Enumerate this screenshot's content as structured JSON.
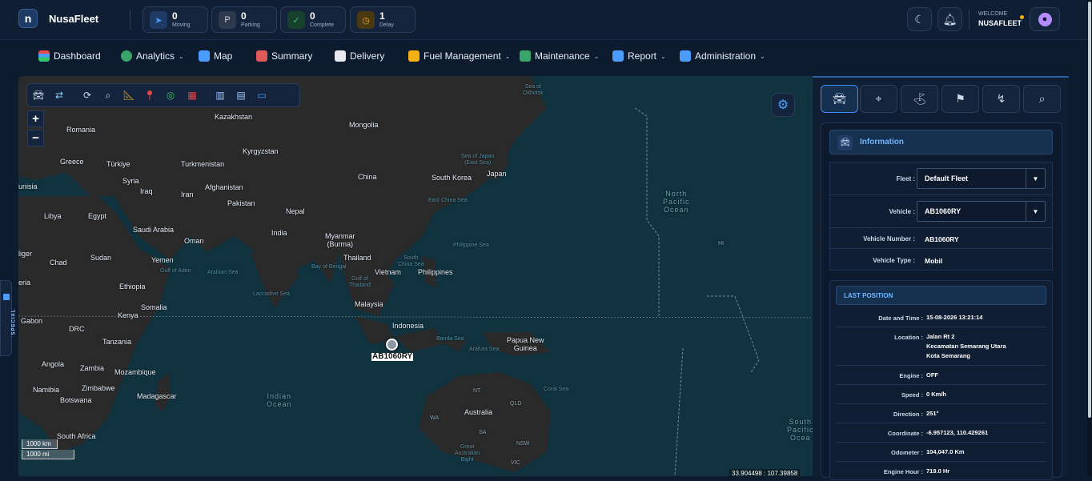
{
  "app": {
    "name": "NusaFleet",
    "logo_letter": "n"
  },
  "stats": [
    {
      "count": "0",
      "label": "Moving",
      "icon": "navigation-icon",
      "color": "#4a9cff"
    },
    {
      "count": "0",
      "label": "Parking",
      "icon": "parking-icon",
      "color": "#c9d2de"
    },
    {
      "count": "0",
      "label": "Complete",
      "icon": "clipboard-check-icon",
      "color": "#35c46a"
    },
    {
      "count": "1",
      "label": "Delay",
      "icon": "clock-icon",
      "color": "#f5b014"
    }
  ],
  "user": {
    "welcome": "WELCOME",
    "name": "NUSAFLEET"
  },
  "nav": [
    {
      "label": "Dashboard",
      "dropdown": false
    },
    {
      "label": "Analytics",
      "dropdown": true
    },
    {
      "label": "Map",
      "dropdown": false
    },
    {
      "label": "Summary",
      "dropdown": false
    },
    {
      "label": "Delivery",
      "dropdown": false
    },
    {
      "label": "Fuel Management",
      "dropdown": true
    },
    {
      "label": "Maintenance",
      "dropdown": true
    },
    {
      "label": "Report",
      "dropdown": true
    },
    {
      "label": "Administration",
      "dropdown": true
    }
  ],
  "side_tab": "SPECIAL",
  "map": {
    "zoom_in": "+",
    "zoom_out": "−",
    "vehicle_label": "AB1060RY",
    "scale_km": "1000 km",
    "scale_mi": "1000 mi",
    "coordinate_readout": "33.904498 : 107.39858",
    "labels": {
      "kazakhstan": "Kazakhstan",
      "mongolia": "Mongolia",
      "romania": "Romania",
      "kyrgyzstan": "Kyrgyzstan",
      "greece": "Greece",
      "turkiye": "Türkiye",
      "turkmenistan": "Turkmenistan",
      "syria": "Syria",
      "iraq": "Iraq",
      "iran": "Iran",
      "afghanistan": "Afghanistan",
      "china": "China",
      "south_korea": "South Korea",
      "japan": "Japan",
      "pakistan": "Pakistan",
      "nepal": "Nepal",
      "libya": "Libya",
      "egypt": "Egypt",
      "saudi": "Saudi Arabia",
      "india": "India",
      "oman": "Oman",
      "myanmar": "Myanmar\n(Burma)",
      "niger": "liger",
      "chad": "Chad",
      "sudan": "Sudan",
      "yemen": "Yemen",
      "thailand": "Thailand",
      "vietnam": "Vietnam",
      "philippines": "Philippines",
      "ethiopia": "Ethiopia",
      "nigeria": "eria",
      "somalia": "Somalia",
      "malaysia": "Malaysia",
      "gabon": "Gabon",
      "kenya": "Kenya",
      "drc": "DRC",
      "indonesia": "Indonesia",
      "png": "Papua New\nGuinea",
      "tanzania": "Tanzania",
      "angola": "Angola",
      "zambia": "Zambia",
      "mozambique": "Mozambique",
      "namibia": "Namibia",
      "zimbabwe": "Zimbabwe",
      "botswana": "Botswana",
      "madagascar": "Madagascar",
      "australia": "Australia",
      "south_africa": "South Africa",
      "tunisia": "unisia"
    },
    "seas": {
      "okhotsk": "Sea of\nOkhotsk",
      "japan_sea": "Sea of Japan\n(East Sea)",
      "east_china": "East China Sea",
      "philippine": "Philippine Sea",
      "south_china": "South\nChina Sea",
      "bengal": "Bay of Bengal",
      "arabian": "Arabian Sea",
      "aden": "Gulf of Aden",
      "laccadive": "Laccadive Sea",
      "thailand_gulf": "Gulf of\nThailand",
      "banda": "Banda Sea",
      "arafura": "Arafura Sea",
      "coral": "Coral Sea",
      "great_bight": "Great\nAustralian\nBight"
    },
    "oceans": {
      "north_pacific": "North\nPacific\nOcean",
      "indian": "Indian\nOcean",
      "south_pacific": "South\nPacific\nOcea"
    },
    "regions": {
      "nt": "NT",
      "qld": "QLD",
      "wa": "WA",
      "sa": "SA",
      "nsw": "NSW",
      "vic": "VIC",
      "hi": "HI"
    }
  },
  "panel": {
    "tabs": [
      {
        "name": "vehicle-tab",
        "icon": "car-icon"
      },
      {
        "name": "location-tab",
        "icon": "pin-icon"
      },
      {
        "name": "route-tab",
        "icon": "route-icon"
      },
      {
        "name": "flag-tab",
        "icon": "flag-icon"
      },
      {
        "name": "trip-tab",
        "icon": "path-icon"
      },
      {
        "name": "search-tab",
        "icon": "search-icon"
      }
    ],
    "info_title": "Information",
    "fleet_label": "Fleet :",
    "fleet_value": "Default Fleet",
    "vehicle_label": "Vehicle :",
    "vehicle_value": "AB1060RY",
    "vehicle_number_label": "Vehicle Number :",
    "vehicle_number_value": "AB1060RY",
    "vehicle_type_label": "Vehicle Type :",
    "vehicle_type_value": "Mobil",
    "last_position_title": "LAST POSITION",
    "last_position": [
      {
        "label": "Date and Time :",
        "value": "15-08-2026 13:21:14"
      },
      {
        "label": "Location :",
        "value": "Jalan Rt 2\nKecamatan Semarang Utara\nKota Semarang"
      },
      {
        "label": "Engine :",
        "value": "OFF"
      },
      {
        "label": "Speed :",
        "value": "0 Km/h"
      },
      {
        "label": "Direction :",
        "value": "251°"
      },
      {
        "label": "Coordinate :",
        "value": "-6.957123, 110.429261"
      },
      {
        "label": "Odometer :",
        "value": "104,047.0 Km"
      },
      {
        "label": "Engine Hour :",
        "value": "719.0 Hr"
      }
    ]
  }
}
